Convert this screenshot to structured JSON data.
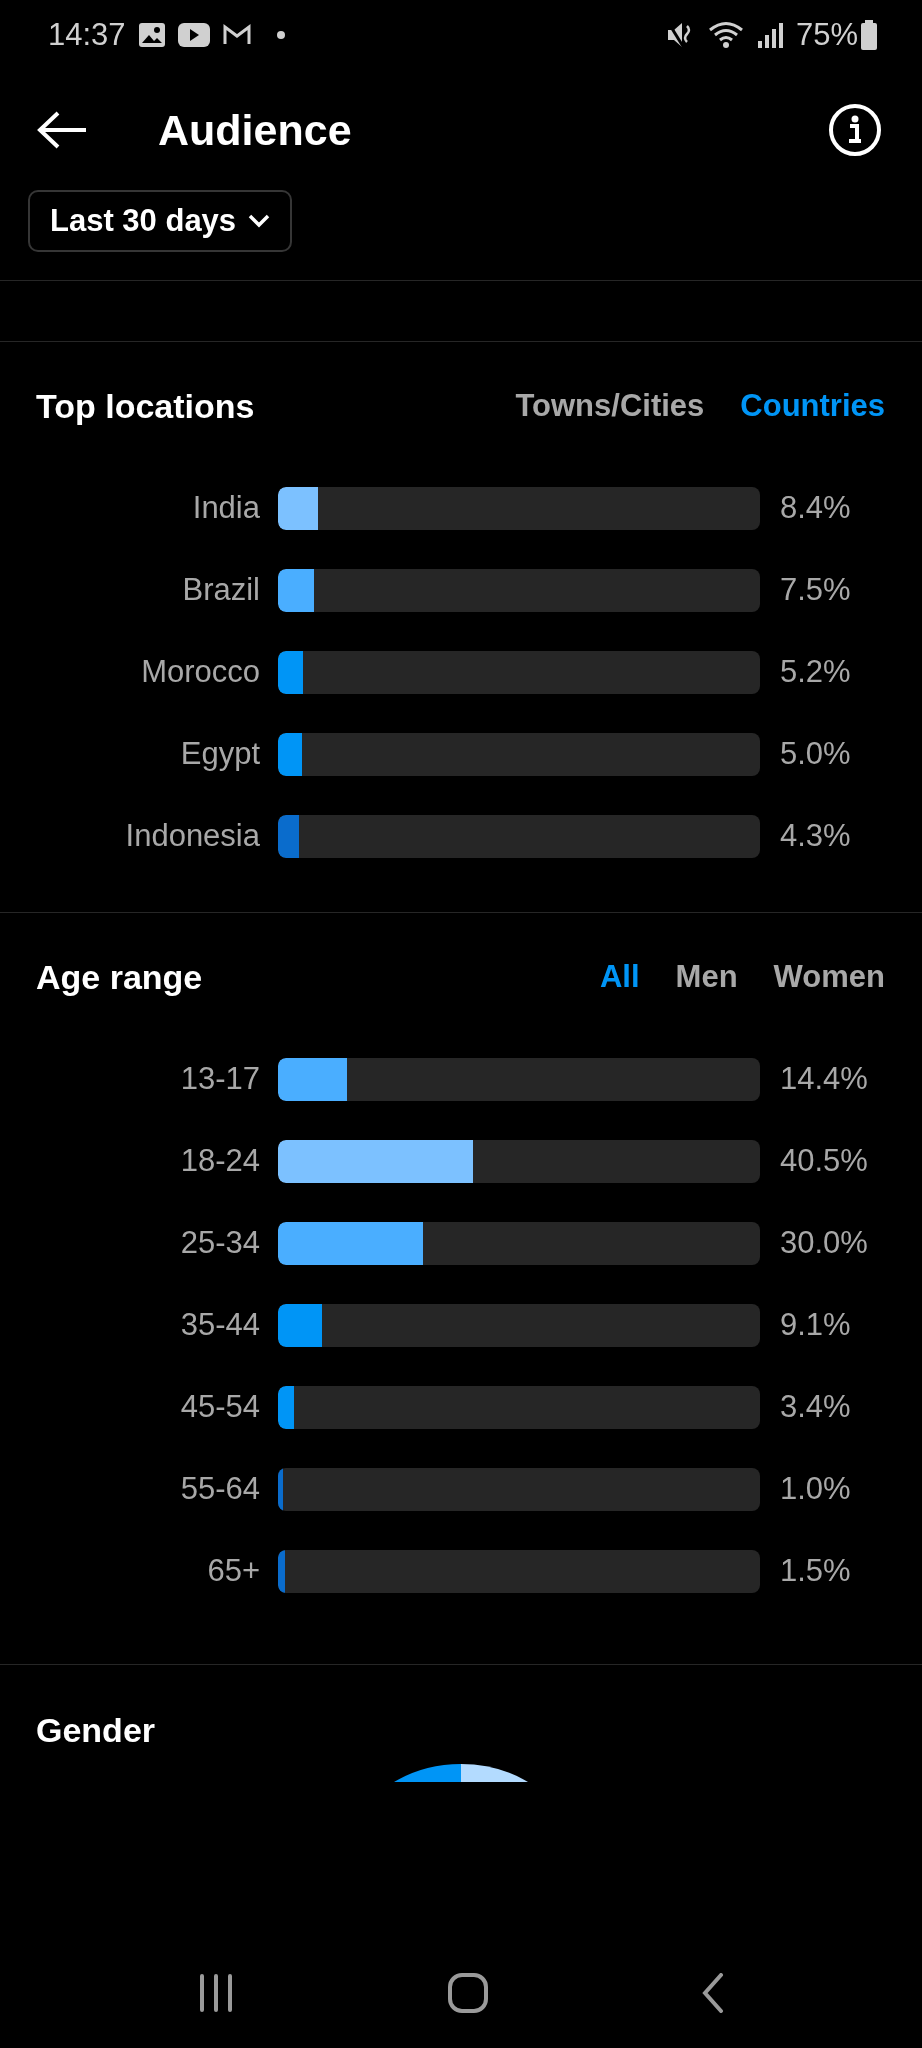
{
  "status_bar": {
    "time": "14:37",
    "battery": "75%"
  },
  "header": {
    "title": "Audience"
  },
  "date_filter": {
    "label": "Last 30 days"
  },
  "top_locations": {
    "title": "Top locations",
    "tabs": [
      {
        "label": "Towns/Cities",
        "selected": false
      },
      {
        "label": "Countries",
        "selected": true
      }
    ],
    "rows": [
      {
        "label": "India",
        "level": 0.084,
        "reading": "8.4%",
        "color": "#7cc1ff"
      },
      {
        "label": "Brazil",
        "level": 0.075,
        "reading": "7.5%",
        "color": "#4aaeff"
      },
      {
        "label": "Morocco",
        "level": 0.052,
        "reading": "5.2%",
        "color": "#0095f6"
      },
      {
        "label": "Egypt",
        "level": 0.05,
        "reading": "5.0%",
        "color": "#0095f6"
      },
      {
        "label": "Indonesia",
        "level": 0.043,
        "reading": "4.3%",
        "color": "#0a6ccc"
      }
    ]
  },
  "age_range": {
    "title": "Age range",
    "tabs": [
      {
        "label": "All",
        "selected": true
      },
      {
        "label": "Men",
        "selected": false
      },
      {
        "label": "Women",
        "selected": false
      }
    ],
    "rows": [
      {
        "label": "13-17",
        "level": 0.144,
        "reading": "14.4%",
        "color": "#4aaeff"
      },
      {
        "label": "18-24",
        "level": 0.405,
        "reading": "40.5%",
        "color": "#7cc1ff"
      },
      {
        "label": "25-34",
        "level": 0.3,
        "reading": "30.0%",
        "color": "#4aaeff"
      },
      {
        "label": "35-44",
        "level": 0.091,
        "reading": "9.1%",
        "color": "#0095f6"
      },
      {
        "label": "45-54",
        "level": 0.034,
        "reading": "3.4%",
        "color": "#0095f6"
      },
      {
        "label": "55-64",
        "level": 0.01,
        "reading": "1.0%",
        "color": "#0a6ccc"
      },
      {
        "label": "65+",
        "level": 0.015,
        "reading": "1.5%",
        "color": "#0a6ccc"
      }
    ]
  },
  "gender": {
    "title": "Gender"
  }
}
